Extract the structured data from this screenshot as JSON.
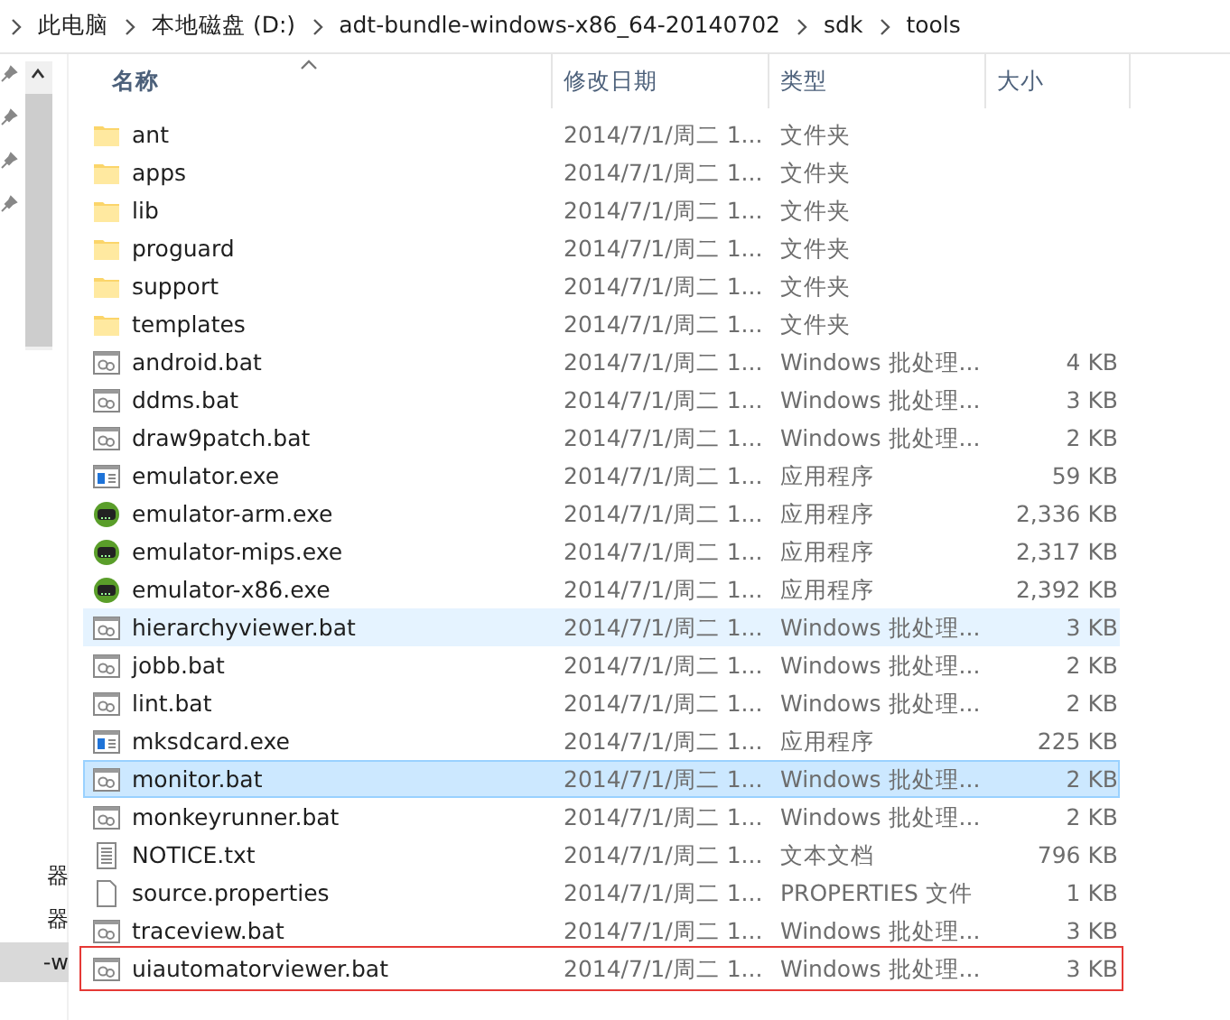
{
  "breadcrumb": [
    "此电脑",
    "本地磁盘 (D:)",
    "adt-bundle-windows-x86_64-20140702",
    "sdk",
    "tools"
  ],
  "nav_pane": {
    "items": [
      {
        "label": "器",
        "selected": false
      },
      {
        "label": "器",
        "selected": false
      },
      {
        "label": "-w",
        "selected": true
      }
    ]
  },
  "columns": [
    {
      "label": "名称",
      "sorted": true
    },
    {
      "label": "修改日期",
      "sorted": false
    },
    {
      "label": "类型",
      "sorted": false
    },
    {
      "label": "大小",
      "sorted": false
    }
  ],
  "rows": [
    {
      "kind": "folder",
      "name": "ant",
      "date": "2014/7/1/周二 1...",
      "type": "文件夹",
      "size": "",
      "selected": false,
      "hovered": false,
      "annotated": false
    },
    {
      "kind": "folder",
      "name": "apps",
      "date": "2014/7/1/周二 1...",
      "type": "文件夹",
      "size": "",
      "selected": false,
      "hovered": false,
      "annotated": false
    },
    {
      "kind": "folder",
      "name": "lib",
      "date": "2014/7/1/周二 1...",
      "type": "文件夹",
      "size": "",
      "selected": false,
      "hovered": false,
      "annotated": false
    },
    {
      "kind": "folder",
      "name": "proguard",
      "date": "2014/7/1/周二 1...",
      "type": "文件夹",
      "size": "",
      "selected": false,
      "hovered": false,
      "annotated": false
    },
    {
      "kind": "folder",
      "name": "support",
      "date": "2014/7/1/周二 1...",
      "type": "文件夹",
      "size": "",
      "selected": false,
      "hovered": false,
      "annotated": false
    },
    {
      "kind": "folder",
      "name": "templates",
      "date": "2014/7/1/周二 1...",
      "type": "文件夹",
      "size": "",
      "selected": false,
      "hovered": false,
      "annotated": false
    },
    {
      "kind": "batch",
      "name": "android.bat",
      "date": "2014/7/1/周二 1...",
      "type": "Windows 批处理...",
      "size": "4 KB",
      "selected": false,
      "hovered": false,
      "annotated": false
    },
    {
      "kind": "batch",
      "name": "ddms.bat",
      "date": "2014/7/1/周二 1...",
      "type": "Windows 批处理...",
      "size": "3 KB",
      "selected": false,
      "hovered": false,
      "annotated": false
    },
    {
      "kind": "batch",
      "name": "draw9patch.bat",
      "date": "2014/7/1/周二 1...",
      "type": "Windows 批处理...",
      "size": "2 KB",
      "selected": false,
      "hovered": false,
      "annotated": false
    },
    {
      "kind": "app",
      "name": "emulator.exe",
      "date": "2014/7/1/周二 1...",
      "type": "应用程序",
      "size": "59 KB",
      "selected": false,
      "hovered": false,
      "annotated": false
    },
    {
      "kind": "emulator",
      "name": "emulator-arm.exe",
      "date": "2014/7/1/周二 1...",
      "type": "应用程序",
      "size": "2,336 KB",
      "selected": false,
      "hovered": false,
      "annotated": false
    },
    {
      "kind": "emulator",
      "name": "emulator-mips.exe",
      "date": "2014/7/1/周二 1...",
      "type": "应用程序",
      "size": "2,317 KB",
      "selected": false,
      "hovered": false,
      "annotated": false
    },
    {
      "kind": "emulator",
      "name": "emulator-x86.exe",
      "date": "2014/7/1/周二 1...",
      "type": "应用程序",
      "size": "2,392 KB",
      "selected": false,
      "hovered": false,
      "annotated": false
    },
    {
      "kind": "batch",
      "name": "hierarchyviewer.bat",
      "date": "2014/7/1/周二 1...",
      "type": "Windows 批处理...",
      "size": "3 KB",
      "selected": false,
      "hovered": true,
      "annotated": false
    },
    {
      "kind": "batch",
      "name": "jobb.bat",
      "date": "2014/7/1/周二 1...",
      "type": "Windows 批处理...",
      "size": "2 KB",
      "selected": false,
      "hovered": false,
      "annotated": false
    },
    {
      "kind": "batch",
      "name": "lint.bat",
      "date": "2014/7/1/周二 1...",
      "type": "Windows 批处理...",
      "size": "2 KB",
      "selected": false,
      "hovered": false,
      "annotated": false
    },
    {
      "kind": "app",
      "name": "mksdcard.exe",
      "date": "2014/7/1/周二 1...",
      "type": "应用程序",
      "size": "225 KB",
      "selected": false,
      "hovered": false,
      "annotated": false
    },
    {
      "kind": "batch",
      "name": "monitor.bat",
      "date": "2014/7/1/周二 1...",
      "type": "Windows 批处理...",
      "size": "2 KB",
      "selected": true,
      "hovered": false,
      "annotated": false
    },
    {
      "kind": "batch",
      "name": "monkeyrunner.bat",
      "date": "2014/7/1/周二 1...",
      "type": "Windows 批处理...",
      "size": "2 KB",
      "selected": false,
      "hovered": false,
      "annotated": false
    },
    {
      "kind": "text",
      "name": "NOTICE.txt",
      "date": "2014/7/1/周二 1...",
      "type": "文本文档",
      "size": "796 KB",
      "selected": false,
      "hovered": false,
      "annotated": false
    },
    {
      "kind": "file",
      "name": "source.properties",
      "date": "2014/7/1/周二 1...",
      "type": "PROPERTIES 文件",
      "size": "1 KB",
      "selected": false,
      "hovered": false,
      "annotated": false
    },
    {
      "kind": "batch",
      "name": "traceview.bat",
      "date": "2014/7/1/周二 1...",
      "type": "Windows 批处理...",
      "size": "3 KB",
      "selected": false,
      "hovered": false,
      "annotated": false
    },
    {
      "kind": "batch",
      "name": "uiautomatorviewer.bat",
      "date": "2014/7/1/周二 1...",
      "type": "Windows 批处理...",
      "size": "3 KB",
      "selected": false,
      "hovered": false,
      "annotated": true
    }
  ]
}
